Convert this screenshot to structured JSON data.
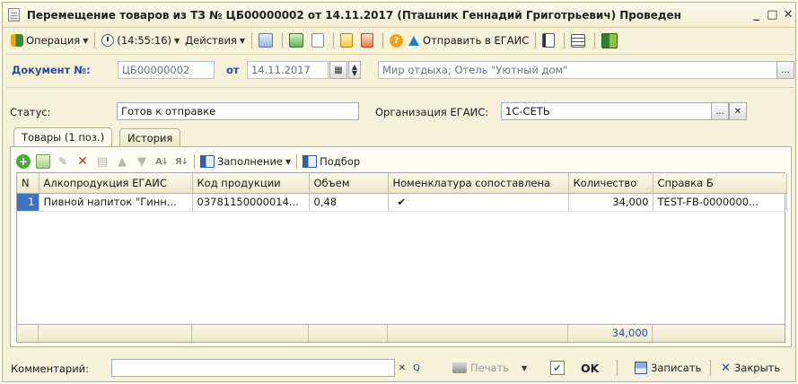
{
  "window": {
    "title": "Перемещение товаров из ТЗ № ЦБ00000002 от 14.11.2017 (Пташник Геннадий Григотрьевич) Проведен",
    "minimize": "_",
    "maximize": "□",
    "close": "✕"
  },
  "toolbar": {
    "operation": "Операция",
    "time": "(14:55:16)",
    "actions": "Действия",
    "send_egais": "Отправить в ЕГАИС",
    "help": "?"
  },
  "document": {
    "label": "Документ №:",
    "number": "ЦБ00000002",
    "date_label": "от",
    "date": "14.11.2017",
    "warehouse": "Мир отдыха; Отель \"Уютный дом\"",
    "more": "..."
  },
  "status": {
    "label": "Статус:",
    "value": "Готов к отправке",
    "org_label": "Организация ЕГАИС:",
    "org_value": "1С-СЕТЬ",
    "more": "...",
    "clear": "✕"
  },
  "tabs": [
    {
      "label": "Товары (1 поз.)",
      "active": true
    },
    {
      "label": "История",
      "active": false
    }
  ],
  "grid_toolbar": {
    "fill": "Заполнение",
    "pick": "Подбор"
  },
  "table": {
    "columns": [
      "N",
      "Алкопродукция ЕГАИС",
      "Код продукции",
      "Объем",
      "Номенклатура сопоставлена",
      "Количество",
      "Справка Б"
    ],
    "rows": [
      {
        "n": "1",
        "product": "Пивной напиток \"Гинн...",
        "code": "03781150000014...",
        "volume": "0,48",
        "matched": "✔",
        "quantity": "34,000",
        "certificate": "TEST-FB-0000000..."
      }
    ],
    "total_quantity": "34,000"
  },
  "bottom": {
    "comment_label": "Комментарий:",
    "comment_value": "",
    "clear": "✕",
    "search": "Q",
    "print": "Печать",
    "ok": "OK",
    "save": "Записать",
    "close": "Закрыть"
  }
}
